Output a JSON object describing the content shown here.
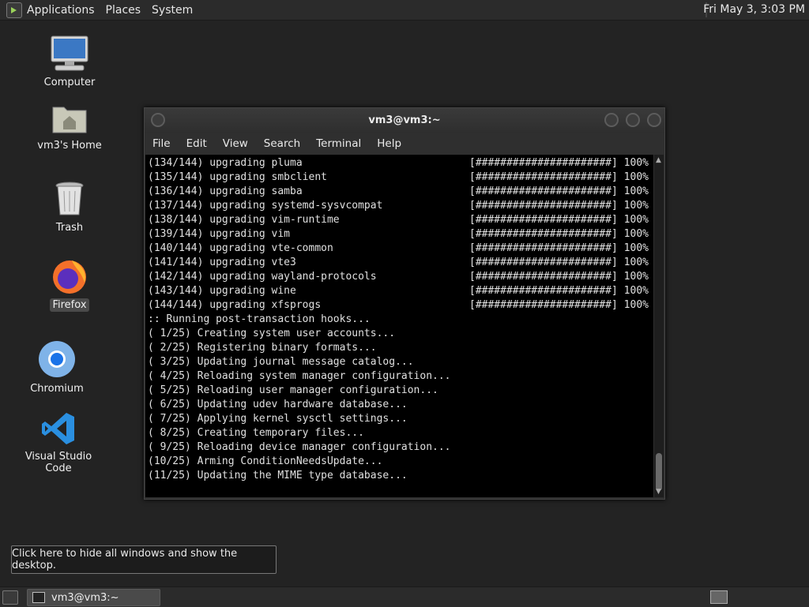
{
  "top_panel": {
    "menus": [
      "Applications",
      "Places",
      "System"
    ],
    "clock": "Fri May  3,  3:03 PM"
  },
  "desktop_icons": [
    {
      "label": "Computer",
      "icon": "computer-icon"
    },
    {
      "label": "vm3's Home",
      "icon": "home-folder-icon"
    },
    {
      "label": "Trash",
      "icon": "trash-icon"
    },
    {
      "label": "Firefox",
      "icon": "firefox-icon",
      "selected": true
    },
    {
      "label": "Chromium",
      "icon": "chromium-icon"
    },
    {
      "label": "Visual Studio Code",
      "icon": "vscode-icon"
    }
  ],
  "terminal": {
    "title": "vm3@vm3:~",
    "menus": [
      "File",
      "Edit",
      "View",
      "Search",
      "Terminal",
      "Help"
    ],
    "lines": [
      {
        "text": "(134/144) upgrading pluma",
        "bar": "[######################] 100%"
      },
      {
        "text": "(135/144) upgrading smbclient",
        "bar": "[######################] 100%"
      },
      {
        "text": "(136/144) upgrading samba",
        "bar": "[######################] 100%"
      },
      {
        "text": "(137/144) upgrading systemd-sysvcompat",
        "bar": "[######################] 100%"
      },
      {
        "text": "(138/144) upgrading vim-runtime",
        "bar": "[######################] 100%"
      },
      {
        "text": "(139/144) upgrading vim",
        "bar": "[######################] 100%"
      },
      {
        "text": "(140/144) upgrading vte-common",
        "bar": "[######################] 100%"
      },
      {
        "text": "(141/144) upgrading vte3",
        "bar": "[######################] 100%"
      },
      {
        "text": "(142/144) upgrading wayland-protocols",
        "bar": "[######################] 100%"
      },
      {
        "text": "(143/144) upgrading wine",
        "bar": "[######################] 100%"
      },
      {
        "text": "(144/144) upgrading xfsprogs",
        "bar": "[######################] 100%"
      },
      {
        "text": ":: Running post-transaction hooks...",
        "bar": ""
      },
      {
        "text": "( 1/25) Creating system user accounts...",
        "bar": ""
      },
      {
        "text": "( 2/25) Registering binary formats...",
        "bar": ""
      },
      {
        "text": "( 3/25) Updating journal message catalog...",
        "bar": ""
      },
      {
        "text": "( 4/25) Reloading system manager configuration...",
        "bar": ""
      },
      {
        "text": "( 5/25) Reloading user manager configuration...",
        "bar": ""
      },
      {
        "text": "( 6/25) Updating udev hardware database...",
        "bar": ""
      },
      {
        "text": "( 7/25) Applying kernel sysctl settings...",
        "bar": ""
      },
      {
        "text": "( 8/25) Creating temporary files...",
        "bar": ""
      },
      {
        "text": "( 9/25) Reloading device manager configuration...",
        "bar": ""
      },
      {
        "text": "(10/25) Arming ConditionNeedsUpdate...",
        "bar": ""
      },
      {
        "text": "(11/25) Updating the MIME type database...",
        "bar": ""
      }
    ]
  },
  "tooltip": "Click here to hide all windows and show the desktop.",
  "taskbar": {
    "window_button": "vm3@vm3:~"
  }
}
